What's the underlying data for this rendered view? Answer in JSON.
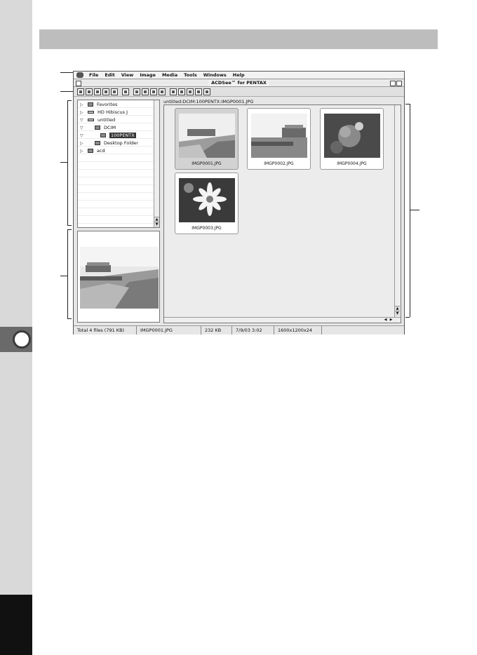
{
  "window": {
    "title": "ACDSee™ for PENTAX",
    "menu": [
      "File",
      "Edit",
      "View",
      "Image",
      "Media",
      "Tools",
      "Windows",
      "Help"
    ]
  },
  "toolbar": {
    "icons": [
      "browse-icon",
      "open-icon",
      "copy-icon",
      "move-icon",
      "delete-icon",
      "find-icon",
      "view-icon",
      "print-icon",
      "slideshow-icon",
      "info-icon",
      "properties-icon",
      "thumbnails-icon",
      "list-icon",
      "details-icon",
      "large-icon"
    ]
  },
  "tree": {
    "items": [
      {
        "label": "Favorites",
        "icon": "folder-icon",
        "expanded": false
      },
      {
        "label": "HD Hibiscus J",
        "icon": "drive-icon",
        "expanded": false
      },
      {
        "label": "untitled",
        "icon": "drive-icon",
        "expanded": true
      },
      {
        "label": "DCIM",
        "icon": "folder-icon",
        "expanded": true
      },
      {
        "label": "100PENTX",
        "icon": "folder-icon",
        "expanded": false,
        "selected": true
      },
      {
        "label": "Desktop Folder",
        "icon": "folder-icon",
        "expanded": false
      },
      {
        "label": "acd",
        "icon": "folder-icon",
        "expanded": false
      }
    ]
  },
  "browser": {
    "path": "untitled:DCIM:100PENTX:IMGP0001.JPG",
    "thumbnails": [
      {
        "name": "IMGP0001.JPG",
        "selected": true
      },
      {
        "name": "IMGP0002.JPG",
        "selected": false
      },
      {
        "name": "IMGP0004.JPG",
        "selected": false
      },
      {
        "name": "IMGP0003.JPG",
        "selected": false
      }
    ]
  },
  "status": {
    "total": "Total 4 files (791 KB)",
    "file": "IMGP0001.JPG",
    "size": "232 KB",
    "date": "7/9/03 3:02",
    "dimensions": "1600x1200x24"
  }
}
